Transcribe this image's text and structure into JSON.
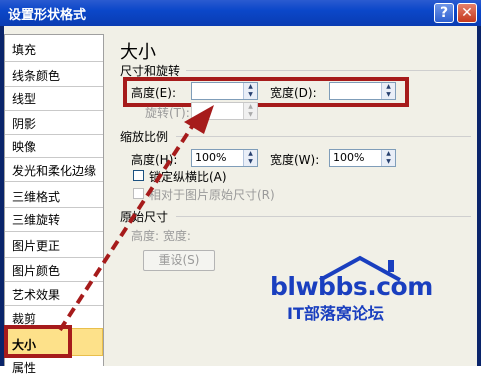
{
  "window": {
    "title": "设置形状格式",
    "help_icon": "?",
    "close_icon": "✕"
  },
  "sidebar": {
    "items": [
      {
        "label": "填充"
      },
      {
        "label": "线条颜色"
      },
      {
        "label": "线型"
      },
      {
        "label": "阴影"
      },
      {
        "label": "映像"
      },
      {
        "label": "发光和柔化边缘"
      },
      {
        "label": "三维格式"
      },
      {
        "label": "三维旋转"
      },
      {
        "label": "图片更正"
      },
      {
        "label": "图片颜色"
      },
      {
        "label": "艺术效果"
      },
      {
        "label": "裁剪"
      },
      {
        "label": "大小"
      },
      {
        "label": "属性"
      }
    ],
    "selected": "大小"
  },
  "panel": {
    "heading": "大小",
    "size_rotate": {
      "title": "尺寸和旋转",
      "height_label": "高度(E):",
      "height_value": "",
      "width_label": "宽度(D):",
      "width_value": "",
      "rotation_label": "旋转(T):"
    },
    "scale": {
      "title": "缩放比例",
      "height_label": "高度(H):",
      "height_value": "100%",
      "width_label": "宽度(W):",
      "width_value": "100%",
      "lock_label": "锁定纵横比(A)",
      "relative_label": "相对于图片原始尺寸(R)"
    },
    "original": {
      "title": "原始尺寸",
      "text": "高度:   宽度:",
      "reset_label": "重设(S)"
    }
  },
  "watermark": {
    "site": "blwbbs.com",
    "forum": "IT部落窝论坛"
  },
  "colors": {
    "highlight": "#a61b1b",
    "watermark_blue": "#1a3fbf",
    "title_bar": "#0b47c9"
  }
}
